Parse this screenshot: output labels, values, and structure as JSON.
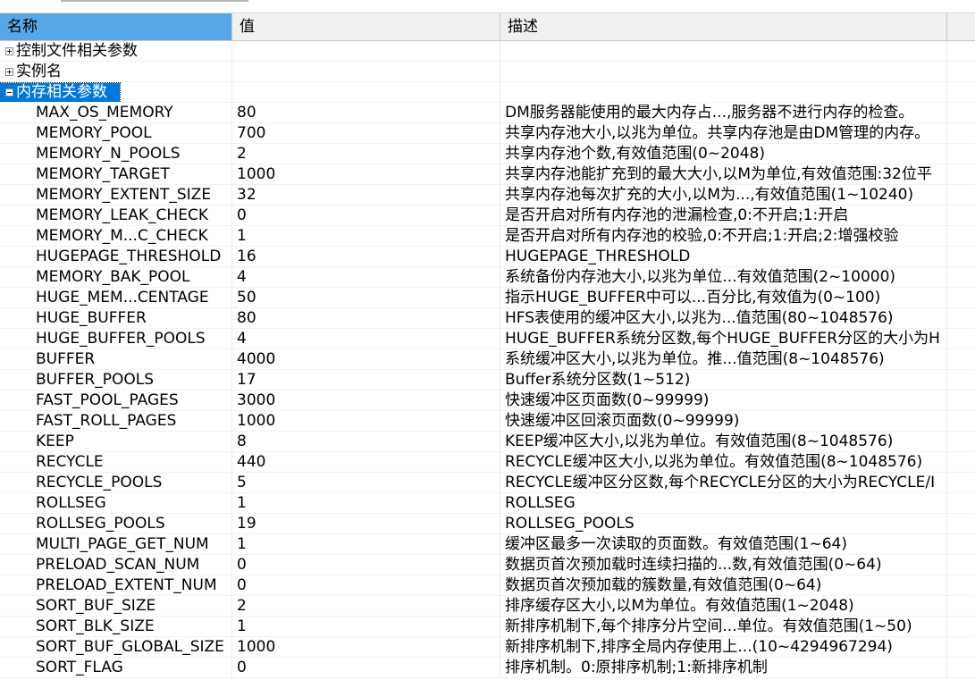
{
  "columns": {
    "name": "名称",
    "value": "值",
    "description": "描述"
  },
  "groups": [
    {
      "label": "控制文件相关参数",
      "icon": "plus-icon"
    },
    {
      "label": "实例名",
      "icon": "plus-icon"
    },
    {
      "label": "内存相关参数",
      "icon": "minus-icon"
    }
  ],
  "params": [
    {
      "name": "MAX_OS_MEMORY",
      "value": "80",
      "desc": "DM服务器能使用的最大内存占...,服务器不进行内存的检查。"
    },
    {
      "name": "MEMORY_POOL",
      "value": "700",
      "desc": "共享内存池大小,以兆为单位。共享内存池是由DM管理的内存。"
    },
    {
      "name": "MEMORY_N_POOLS",
      "value": "2",
      "desc": "共享内存池个数,有效值范围(0~2048)"
    },
    {
      "name": "MEMORY_TARGET",
      "value": "1000",
      "desc": "共享内存池能扩充到的最大大小,以M为单位,有效值范围:32位平"
    },
    {
      "name": "MEMORY_EXTENT_SIZE",
      "value": "32",
      "desc": "共享内存池每次扩充的大小,以M为...,有效值范围(1~10240)"
    },
    {
      "name": "MEMORY_LEAK_CHECK",
      "value": "0",
      "desc": "是否开启对所有内存池的泄漏检查,0:不开启;1:开启"
    },
    {
      "name": "MEMORY_M...C_CHECK",
      "value": "1",
      "desc": "是否开启对所有内存池的校验,0:不开启;1:开启;2:增强校验"
    },
    {
      "name": "HUGEPAGE_THRESHOLD",
      "value": "16",
      "desc": "HUGEPAGE_THRESHOLD"
    },
    {
      "name": "MEMORY_BAK_POOL",
      "value": "4",
      "desc": "系统备份内存池大小,以兆为单位...有效值范围(2~10000)"
    },
    {
      "name": "HUGE_MEM...CENTAGE",
      "value": "50",
      "desc": "指示HUGE_BUFFER中可以...百分比,有效值为(0~100)"
    },
    {
      "name": "HUGE_BUFFER",
      "value": "80",
      "desc": "HFS表使用的缓冲区大小,以兆为...值范围(80~1048576)"
    },
    {
      "name": "HUGE_BUFFER_POOLS",
      "value": "4",
      "desc": "HUGE_BUFFER系统分区数,每个HUGE_BUFFER分区的大小为H"
    },
    {
      "name": "BUFFER",
      "value": "4000",
      "desc": "系统缓冲区大小,以兆为单位。推...值范围(8~1048576)"
    },
    {
      "name": "BUFFER_POOLS",
      "value": "17",
      "desc": "Buffer系统分区数(1~512)"
    },
    {
      "name": "FAST_POOL_PAGES",
      "value": "3000",
      "desc": "快速缓冲区页面数(0~99999)"
    },
    {
      "name": "FAST_ROLL_PAGES",
      "value": "1000",
      "desc": "快速缓冲区回滚页面数(0~99999)"
    },
    {
      "name": "KEEP",
      "value": "8",
      "desc": "KEEP缓冲区大小,以兆为单位。有效值范围(8~1048576)"
    },
    {
      "name": "RECYCLE",
      "value": "440",
      "desc": "RECYCLE缓冲区大小,以兆为单位。有效值范围(8~1048576)"
    },
    {
      "name": "RECYCLE_POOLS",
      "value": "5",
      "desc": "RECYCLE缓冲区分区数,每个RECYCLE分区的大小为RECYCLE/I"
    },
    {
      "name": "ROLLSEG",
      "value": "1",
      "desc": "ROLLSEG"
    },
    {
      "name": "ROLLSEG_POOLS",
      "value": "19",
      "desc": "ROLLSEG_POOLS"
    },
    {
      "name": "MULTI_PAGE_GET_NUM",
      "value": "1",
      "desc": "缓冲区最多一次读取的页面数。有效值范围(1~64)"
    },
    {
      "name": "PRELOAD_SCAN_NUM",
      "value": "0",
      "desc": "数据页首次预加载时连续扫描的...数,有效值范围(0~64)"
    },
    {
      "name": "PRELOAD_EXTENT_NUM",
      "value": "0",
      "desc": "数据页首次预加载的簇数量,有效值范围(0~64)"
    },
    {
      "name": "SORT_BUF_SIZE",
      "value": "2",
      "desc": "排序缓存区大小,以M为单位。有效值范围(1~2048)"
    },
    {
      "name": "SORT_BLK_SIZE",
      "value": "1",
      "desc": "新排序机制下,每个排序分片空间...单位。有效值范围(1~50)"
    },
    {
      "name": "SORT_BUF_GLOBAL_SIZE",
      "value": "1000",
      "desc": "新排序机制下,排序全局内存使用上...(10~4294967294)"
    },
    {
      "name": "SORT_FLAG",
      "value": "0",
      "desc": "排序机制。0:原排序机制;1:新排序机制"
    }
  ]
}
